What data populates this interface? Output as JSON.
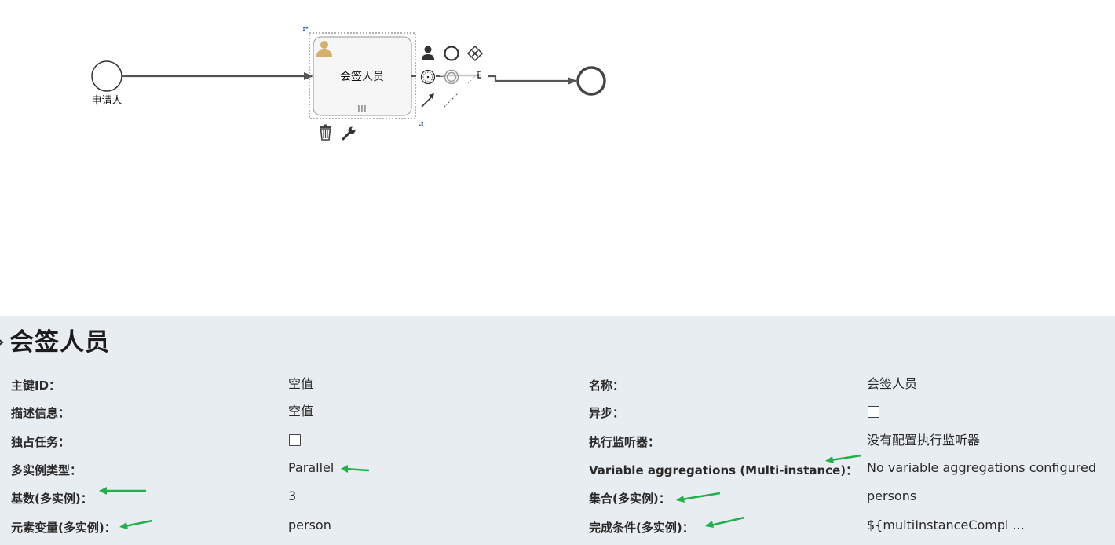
{
  "diagram": {
    "start_event_label": "申请人",
    "user_task_label": "会签人员",
    "colors": {
      "stroke": "#555555",
      "task_fill": "#f6f6f6",
      "selection": "#666666",
      "handle": "#3366cc",
      "user_icon": "#d4b06a"
    },
    "context_pad_icons": [
      "user-task-icon",
      "intermediate-event-icon",
      "gateway-icon",
      "timer-event-icon",
      "end-event-icon",
      "text-annotation-icon",
      "sequence-flow-icon",
      "association-icon",
      "delete-icon",
      "wrench-icon"
    ]
  },
  "properties": {
    "title": "会签人员",
    "rows": [
      {
        "label": "主键ID：",
        "value": "空值"
      },
      {
        "label": "描述信息：",
        "value": "空值"
      },
      {
        "label": "独占任务：",
        "value": ""
      },
      {
        "label": "多实例类型：",
        "value": "Parallel"
      },
      {
        "label": "基数(多实例)：",
        "value": "3"
      },
      {
        "label": "元素变量(多实例)：",
        "value": "person"
      }
    ],
    "right_rows": [
      {
        "label": "名称：",
        "value": "会签人员"
      },
      {
        "label": "异步：",
        "value": ""
      },
      {
        "label": "执行监听器：",
        "value": "没有配置执行监听器"
      },
      {
        "label": "Variable aggregations (Multi-instance)：",
        "value": "No variable aggregations configured"
      },
      {
        "label": "集合(多实例)：",
        "value": "persons"
      },
      {
        "label": "完成条件(多实例)：",
        "value": "${multiInstanceCompl ..."
      }
    ],
    "annotation_color": "#22b04b"
  }
}
